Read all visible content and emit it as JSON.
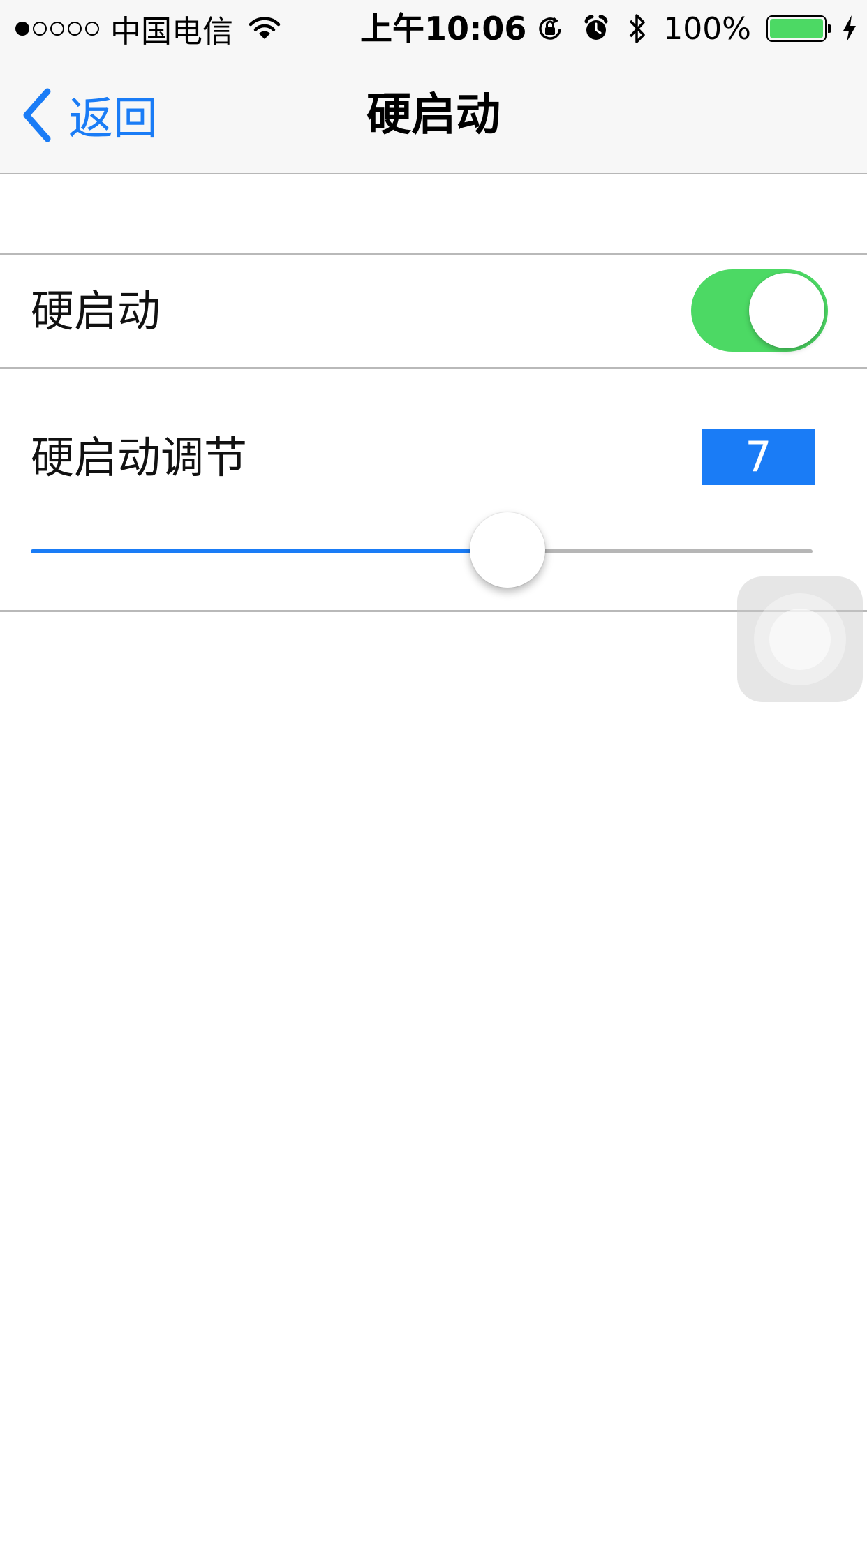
{
  "status_bar": {
    "signal_dots": [
      true,
      false,
      false,
      false,
      false
    ],
    "carrier": "中国电信",
    "time": "上午10:06",
    "battery_percent": "100%",
    "battery_level": 1.0,
    "battery_color": "#4cd964",
    "icons": [
      "wifi-icon",
      "orientation-lock-icon",
      "alarm-icon",
      "bluetooth-icon",
      "battery-icon",
      "charging-bolt-icon"
    ]
  },
  "nav": {
    "back_label": "返回",
    "title": "硬启动",
    "accent_color": "#1a7cf6"
  },
  "settings": {
    "hard_start_label": "硬启动",
    "hard_start_enabled": true,
    "toggle_color": "#4cd964",
    "adjust_label": "硬启动调节",
    "adjust_value": "7",
    "slider_fraction": 0.61
  }
}
